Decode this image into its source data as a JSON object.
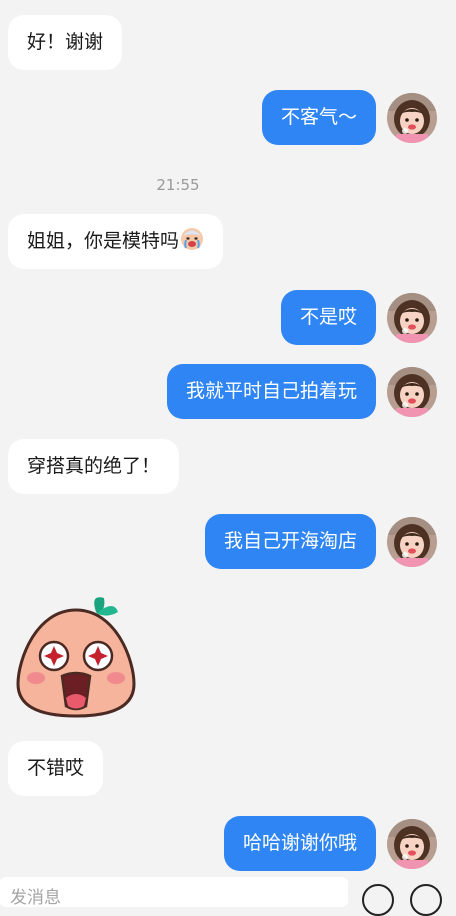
{
  "messages": [
    {
      "id": "m1",
      "text": "好！谢谢"
    },
    {
      "id": "m2",
      "text": "不客气～"
    },
    {
      "id": "m3",
      "text": "姐姐，你是模特吗"
    },
    {
      "id": "m4",
      "text": "不是哎"
    },
    {
      "id": "m5",
      "text": "我就平时自己拍着玩"
    },
    {
      "id": "m6",
      "text": "穿搭真的绝了！"
    },
    {
      "id": "m7",
      "text": "我自己开海淘店"
    },
    {
      "id": "m9",
      "text": "不错哎"
    },
    {
      "id": "m10",
      "text": "哈哈谢谢你哦"
    }
  ],
  "timestamp": "21:55",
  "input": {
    "placeholder": "发消息"
  },
  "icons": {
    "inline_emoji": "crying-face-icon",
    "sticker": "peach-mochi-sticker-icon",
    "emoji_button": "emoji-face-icon",
    "plus_button": "plus-circle-icon"
  },
  "colors": {
    "background": "#f3f3f3",
    "incoming_bubble": "#ffffff",
    "outgoing_bubble": "#2e85f3"
  }
}
